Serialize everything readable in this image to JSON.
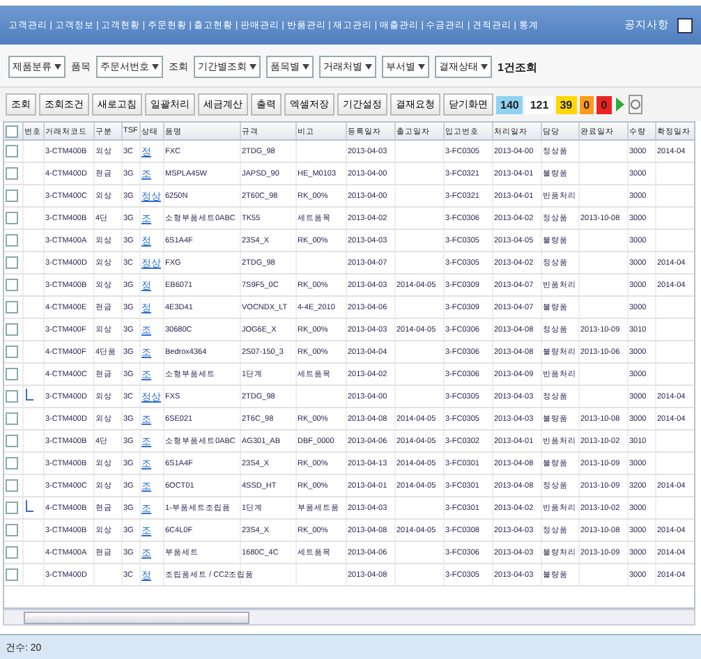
{
  "window": {
    "title": "고객관리 | 고객정보 | 고객현황 | 주문현황 | 출고현황 | 판매관리 | 반품관리 | 재고관리 | 매출관리 | 수금관리 | 견적관리 | 통계",
    "right_text": "공지사항"
  },
  "filters": [
    {
      "kind": "select",
      "value": "제품분류"
    },
    {
      "kind": "label",
      "value": "품목"
    },
    {
      "kind": "select",
      "value": "주문서번호"
    },
    {
      "kind": "label",
      "value": "조회"
    },
    {
      "kind": "select",
      "value": "기간별조회"
    },
    {
      "kind": "select",
      "value": "품목별"
    },
    {
      "kind": "select",
      "value": "거래처별"
    },
    {
      "kind": "select",
      "value": "부서별"
    },
    {
      "kind": "select",
      "value": "결재상태"
    },
    {
      "kind": "bold",
      "value": "1건조회"
    }
  ],
  "buttons": [
    "조회",
    "조회조건",
    "새로고침",
    "일괄처리",
    "세금계산",
    "출력",
    "엑셀저장",
    "기간설정",
    "결재요청",
    "닫기화면"
  ],
  "counters": [
    {
      "value": "140",
      "color": "#8fd3f4"
    },
    {
      "value": "121",
      "color": "#ffffff"
    },
    {
      "value": "39",
      "color": "#ffd700"
    },
    {
      "value": "0",
      "color": "#ff9a1a"
    },
    {
      "value": "0",
      "color": "#ee2222"
    }
  ],
  "table": {
    "all_checked": false,
    "columns": [
      "번호",
      "거래처코드",
      "구분",
      "TSF",
      "상태",
      "품명",
      "규격",
      "비고",
      "등록일자",
      "출고일자",
      "입고번호",
      "처리일자",
      "담당",
      "완료일자",
      "수량",
      "확정일자"
    ],
    "rows": [
      {
        "tree": false,
        "checked": false,
        "cells": [
          "",
          "3-CTM400B",
          "외상",
          "3C",
          "정",
          "FXC",
          "2TDG_98",
          "",
          "2013-04-03",
          "",
          "3-FC0305",
          "2013-04-00",
          "정상품",
          "",
          "3000",
          "2014-04"
        ]
      },
      {
        "tree": false,
        "checked": false,
        "cells": [
          "",
          "4-CTM400D",
          "현금",
          "3G",
          "조",
          "MSPLA45W",
          "JAPSD_90",
          "HE_M0103",
          "2013-04-00",
          "",
          "3-FC0321",
          "2013-04-01",
          "불량품",
          "",
          "3000",
          ""
        ]
      },
      {
        "tree": false,
        "checked": false,
        "cells": [
          "",
          "3-CTM400C",
          "외상",
          "3G",
          "정상",
          "6250N",
          "2T60C_98",
          "RK_00%",
          "2013-04-00",
          "",
          "3-FC0321",
          "2013-04-01",
          "반품처리",
          "",
          "3000",
          ""
        ]
      },
      {
        "tree": false,
        "checked": false,
        "cells": [
          "",
          "3-CTM400B",
          "4단",
          "3G",
          "조",
          "소형부품세트0ABC",
          "TK55",
          "세트품목",
          "2013-04-02",
          "",
          "3-FC0306",
          "2013-04-02",
          "정상품",
          "2013-10-08",
          "3000",
          ""
        ]
      },
      {
        "tree": false,
        "checked": false,
        "cells": [
          "",
          "3-CTM400A",
          "외상",
          "3G",
          "정",
          "6S1A4F",
          "23S4_X",
          "RK_00%",
          "2013-04-03",
          "",
          "3-FC0305",
          "2013-04-05",
          "불량품",
          "",
          "3000",
          ""
        ]
      },
      {
        "tree": false,
        "checked": false,
        "cells": [
          "",
          "3-CTM400D",
          "외상",
          "3C",
          "정상",
          "FXG",
          "2TDG_98",
          "",
          "2013-04-07",
          "",
          "3-FC0305",
          "2013-04-02",
          "정상품",
          "",
          "3000",
          "2014-04"
        ]
      },
      {
        "tree": false,
        "checked": false,
        "cells": [
          "",
          "3-CTM400B",
          "외상",
          "3G",
          "정",
          "EB6071",
          "7S9F5_0C",
          "RK_00%",
          "2013-04-03",
          "2014-04-05",
          "3-FC0309",
          "2013-04-07",
          "반품처리",
          "",
          "3000",
          "2014-04"
        ]
      },
      {
        "tree": false,
        "checked": false,
        "cells": [
          "",
          "4-CTM400E",
          "현금",
          "3G",
          "정",
          "4E3D41",
          "VOCNDX_LT",
          "4-4E_2010",
          "2013-04-06",
          "",
          "3-FC0309",
          "2013-04-07",
          "불량품",
          "",
          "3000",
          ""
        ]
      },
      {
        "tree": false,
        "checked": false,
        "cells": [
          "",
          "3-CTM400F",
          "외상",
          "3G",
          "조",
          "30680C",
          "JOG6E_X",
          "RK_00%",
          "2013-04-03",
          "2014-04-05",
          "3-FC0306",
          "2013-04-08",
          "정상품",
          "2013-10-09",
          "3010",
          ""
        ]
      },
      {
        "tree": false,
        "checked": false,
        "cells": [
          "",
          "4-CTM400F",
          "4단품",
          "3G",
          "조",
          "Bedrox4364",
          "2S07-150_3",
          "RK_00%",
          "2013-04-04",
          "",
          "3-FC0306",
          "2013-04-08",
          "불량처리",
          "2013-10-06",
          "3000",
          ""
        ]
      },
      {
        "tree": false,
        "checked": false,
        "cells": [
          "",
          "4-CTM400C",
          "현금",
          "3G",
          "조",
          "소형부품세트",
          "1단계",
          "세트품목",
          "2013-04-02",
          "",
          "3-FC0306",
          "2013-04-09",
          "반품처리",
          "",
          "3000",
          ""
        ]
      },
      {
        "tree": true,
        "checked": false,
        "cells": [
          "",
          "3-CTM400D",
          "외상",
          "3C",
          "정상",
          "FXS",
          "2TDG_98",
          "",
          "2013-04-00",
          "",
          "3-FC0305",
          "2013-04-03",
          "정상품",
          "",
          "3000",
          "2014-04"
        ]
      },
      {
        "tree": false,
        "checked": false,
        "cells": [
          "",
          "3-CTM400D",
          "외상",
          "3G",
          "조",
          "6SE021",
          "2T6C_98",
          "RK_00%",
          "2013-04-08",
          "2014-04-05",
          "3-FC0305",
          "2013-04-03",
          "불량품",
          "2013-10-08",
          "3000",
          "2014-04"
        ]
      },
      {
        "tree": false,
        "checked": false,
        "cells": [
          "",
          "3-CTM400B",
          "4단",
          "3G",
          "조",
          "소형부품세트0ABC",
          "AG301_AB",
          "DBF_0000",
          "2013-04-06",
          "2014-04-05",
          "3-FC0302",
          "2013-04-01",
          "반품처리",
          "2013-10-02",
          "3010",
          ""
        ]
      },
      {
        "tree": false,
        "checked": false,
        "cells": [
          "",
          "3-CTM400B",
          "외상",
          "3G",
          "조",
          "6S1A4F",
          "23S4_X",
          "RK_00%",
          "2013-04-13",
          "2014-04-05",
          "3-FC0301",
          "2013-04-08",
          "불량품",
          "2013-10-09",
          "3000",
          ""
        ]
      },
      {
        "tree": false,
        "checked": false,
        "cells": [
          "",
          "3-CTM400C",
          "외상",
          "3G",
          "조",
          "6OCT01",
          "4SSD_HT",
          "RK_00%",
          "2013-04-01",
          "2014-04-05",
          "3-FC0301",
          "2013-04-08",
          "정상품",
          "2013-10-09",
          "3200",
          "2014-04"
        ]
      },
      {
        "tree": true,
        "checked": false,
        "cells": [
          "",
          "4-CTM400B",
          "현금",
          "3G",
          "조",
          "1-부품세트조립품",
          "1단계",
          "부품세트품",
          "2013-04-03",
          "",
          "3-FC0301",
          "2013-04-02",
          "반품처리",
          "2013-10-02",
          "3000",
          ""
        ]
      },
      {
        "tree": false,
        "checked": false,
        "cells": [
          "",
          "3-CTM400B",
          "외상",
          "3G",
          "조",
          "6C4L0F",
          "23S4_X",
          "RK_00%",
          "2013-04-08",
          "2014-04-05",
          "3-FC0308",
          "2013-04-03",
          "정상품",
          "2013-10-08",
          "3000",
          "2014-04"
        ]
      },
      {
        "tree": false,
        "checked": false,
        "cells": [
          "",
          "4-CTM400A",
          "현금",
          "3G",
          "조",
          "부품세트",
          "1680C_4C",
          "세트품목",
          "2013-04-06",
          "",
          "3-FC0306",
          "2013-04-03",
          "불량처리",
          "2013-10-09",
          "3000",
          "2014-04"
        ]
      },
      {
        "tree": false,
        "checked": false,
        "cells": [
          "",
          "3-CTM400D",
          "",
          "3C",
          "정",
          "조립품세트 / CC2조립품",
          "",
          "",
          "2013-04-08",
          "",
          "3-FC0305",
          "2013-04-03",
          "불량품",
          "",
          "3000",
          "2014-04"
        ]
      }
    ]
  },
  "status_bar": "건수: 20"
}
